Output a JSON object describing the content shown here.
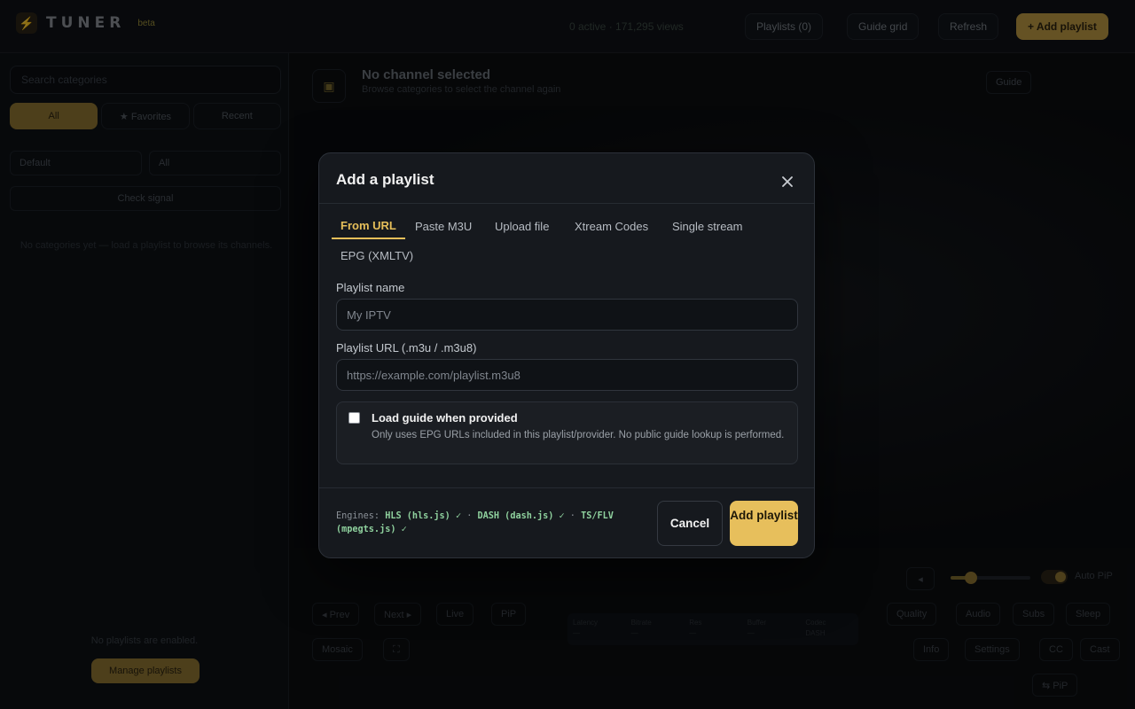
{
  "app": {
    "logo_text": "TUNER",
    "logo_badge": "beta",
    "stats": "0 active · 171,295 views",
    "nav": {
      "playlists": "Playlists (0)",
      "guide_grid": "Guide grid",
      "refresh": "Refresh",
      "add_playlist": "+ Add playlist"
    }
  },
  "sidebar": {
    "search_placeholder": "Search categories",
    "segments": [
      "All",
      "★ Favorites",
      "Recent"
    ],
    "sort_value": "Default",
    "filter_value": "All",
    "check_signal": "Check signal",
    "hint": "No categories yet — load a playlist to browse its channels.",
    "footer": "No playlists are enabled.",
    "manage_button": "Manage playlists"
  },
  "player": {
    "title": "No channel selected",
    "subtitle": "Browse categories to select the channel again",
    "guide_button": "Guide",
    "controls": [
      "◂ Prev",
      "Next ▸",
      "Live",
      "PiP",
      "Mosaic",
      "⛶"
    ],
    "right_controls": [
      "Quality",
      "Audio",
      "Subs",
      "Sleep",
      "Info",
      "Settings",
      "CC",
      "Cast"
    ],
    "auto_pip": "Auto PiP",
    "stats_labels": [
      "Latency",
      "Bitrate",
      "Res",
      "Buffer",
      "Codec"
    ],
    "stats_values": [
      "—",
      "—",
      "—",
      "—",
      "DASH"
    ],
    "footer_tag": "⇆ PiP"
  },
  "modal": {
    "title": "Add a playlist",
    "tabs": [
      "From URL",
      "Paste M3U",
      "Upload file",
      "Xtream Codes",
      "Single stream",
      "EPG (XMLTV)"
    ],
    "active_tab": 0,
    "name_label": "Playlist name",
    "name_placeholder": "My IPTV",
    "name_value": "",
    "url_label": "Playlist URL (.m3u / .m3u8)",
    "url_placeholder": "https://example.com/playlist.m3u8",
    "url_value": "",
    "guide_title": "Load guide when provided",
    "guide_desc": "Only uses EPG URLs included in this playlist/provider. No public guide lookup is performed.",
    "guide_checked": false,
    "engines_prefix": "Engines:",
    "engines": [
      "HLS (hls.js) ✓",
      "DASH (dash.js) ✓",
      "TS/FLV (mpegts.js) ✓"
    ],
    "engine_separator": "·",
    "cancel": "Cancel",
    "add": "Add playlist"
  },
  "colors": {
    "accent": "#e7bf5c",
    "engine_ok": "#8fd19e",
    "panel": "#16191e",
    "backdrop": "#0b0d10"
  },
  "icons": {
    "logo": "bolt-icon",
    "close": "close-icon",
    "channel": "tv-icon"
  }
}
